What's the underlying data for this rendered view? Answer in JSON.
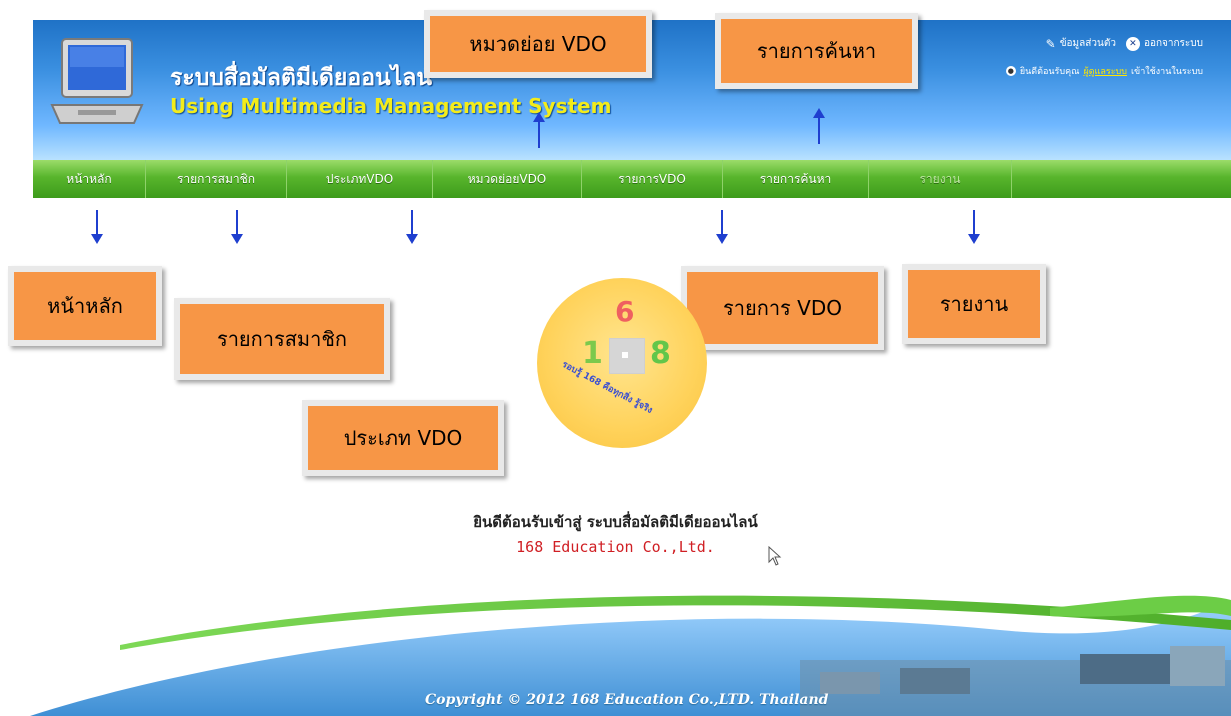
{
  "header": {
    "title_th": "ระบบสื่อมัลติมีเดียออนไลน์",
    "title_en": "Using Multimedia Management System",
    "top_links": [
      {
        "label": "ข้อมูลส่วนตัว",
        "icon": "pencil-icon"
      },
      {
        "label": "ออกจากระบบ",
        "icon": "close-icon"
      }
    ],
    "welcome_prefix": "ยินดีต้อนรับคุณ",
    "welcome_user": "ผู้ดูแลระบบ",
    "welcome_suffix": "เข้าใช้งานในระบบ"
  },
  "nav": {
    "items": [
      {
        "label": "หน้าหลัก"
      },
      {
        "label": "รายการสมาชิก"
      },
      {
        "label": "ประเภทVDO"
      },
      {
        "label": "หมวดย่อยVDO"
      },
      {
        "label": "รายการVDO"
      },
      {
        "label": "รายการค้นหา"
      },
      {
        "label": "รายงาน"
      }
    ]
  },
  "annotations": {
    "subcategory_label": "หมวดย่อย VDO",
    "search_label": "รายการค้นหา",
    "home_label": "หน้าหลัก",
    "members_label": "รายการสมาชิก",
    "type_label": "ประเภท VDO",
    "vdo_list_label": "รายการ VDO",
    "report_label": "รายงาน"
  },
  "logo": {
    "digit_top": "6",
    "digit_left": "1",
    "digit_right": "8",
    "slogan": "รอบรู้ 168 คือทุกสิ่ง รู้จริง"
  },
  "welcome": {
    "line1": "ยินดีต้อนรับเข้าสู่ ระบบสื่อมัลติมีเดียออนไลน์",
    "line2": "168 Education Co.,Ltd."
  },
  "footer": {
    "copyright": "Copyright © 2012 168 Education Co.,LTD. Thailand"
  },
  "colors": {
    "header_blue": "#1f72c6",
    "nav_green": "#58b52c",
    "annotation_orange": "#f79646",
    "arrow_blue": "#1f3fcf",
    "company_red": "#d01f24"
  }
}
